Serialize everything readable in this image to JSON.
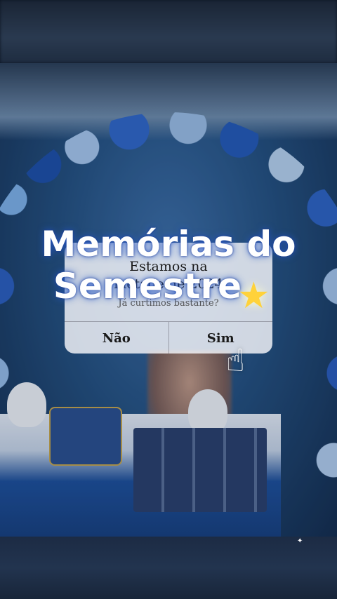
{
  "overlay": {
    "headline_line1": "Memórias do",
    "headline_line2": "Semestre",
    "star_icon": "star-icon",
    "hand_icon": "pointing-hand-icon"
  },
  "dialog": {
    "title_line1": "Estamos na",
    "title_line2": "metade de 2024",
    "subtitle": "Já curtimos bastante?",
    "buttons": {
      "no_label": "Não",
      "yes_label": "Sim"
    }
  },
  "colors": {
    "headline_glow": "#2a5ad0",
    "dialog_bg": "#f6f6fa",
    "balloon_blue": "#2a5cbc"
  }
}
